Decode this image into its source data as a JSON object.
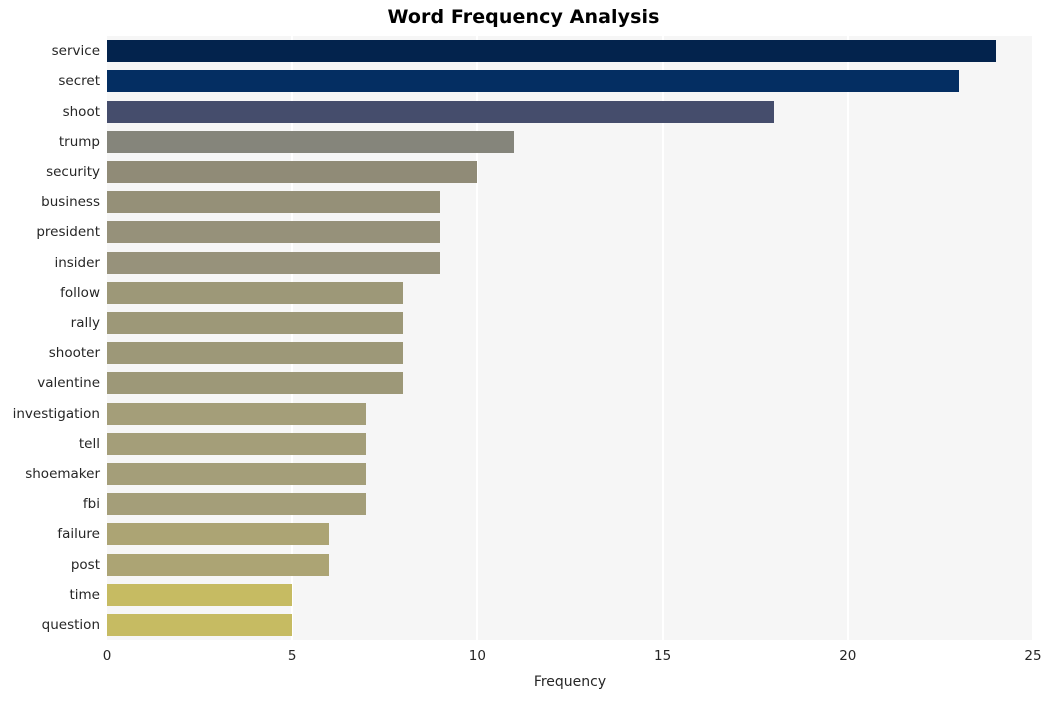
{
  "chart_data": {
    "type": "bar",
    "orientation": "horizontal",
    "title": "Word Frequency Analysis",
    "xlabel": "Frequency",
    "ylabel": "",
    "categories": [
      "service",
      "secret",
      "shoot",
      "trump",
      "security",
      "business",
      "president",
      "insider",
      "follow",
      "rally",
      "shooter",
      "valentine",
      "investigation",
      "tell",
      "shoemaker",
      "fbi",
      "failure",
      "post",
      "time",
      "question"
    ],
    "values": [
      24,
      23,
      18,
      11,
      10,
      9,
      9,
      9,
      8,
      8,
      8,
      8,
      7,
      7,
      7,
      7,
      6,
      6,
      5,
      5
    ],
    "bar_colors": [
      "#03234d",
      "#042e62",
      "#454d6c",
      "#85857b",
      "#908b77",
      "#959078",
      "#96917a",
      "#97927b",
      "#9d9878",
      "#9d9878",
      "#9d9878",
      "#9d9878",
      "#a49e79",
      "#a49e79",
      "#a49e79",
      "#a49e79",
      "#aca474",
      "#aca474",
      "#c6bb62",
      "#c6bb62"
    ],
    "xlim": [
      0,
      25
    ],
    "xticks": [
      0,
      5,
      10,
      15,
      20,
      25
    ],
    "xtick_labels": [
      "0",
      "5",
      "10",
      "15",
      "20",
      "25"
    ],
    "grid": true,
    "grid_axis": "x",
    "plot_background": "#f6f6f6",
    "grid_color": "#ffffff",
    "figure_background": "#ffffff",
    "legend": null
  }
}
